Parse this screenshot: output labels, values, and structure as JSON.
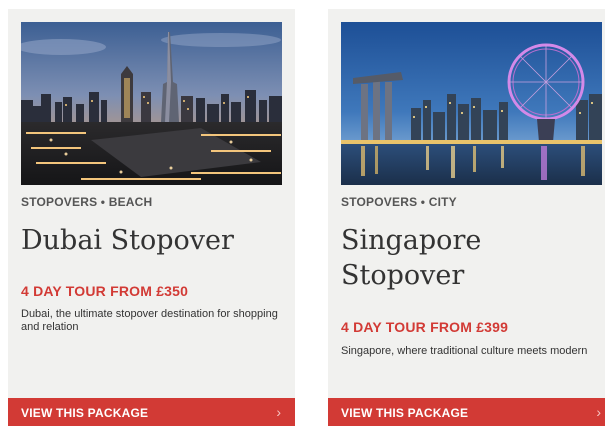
{
  "cards": [
    {
      "image_label": "Dubai skyline at dusk",
      "tags": "STOPOVERS • BEACH",
      "title": "Dubai Stopover",
      "price": "4 DAY TOUR FROM £350",
      "description": "Dubai, the ultimate stopover destination for shopping and relation",
      "cta": "VIEW THIS PACKAGE",
      "cta_icon": "chevron-right-icon"
    },
    {
      "image_label": "Singapore skyline at night",
      "tags": "STOPOVERS • CITY",
      "title": "Singapore Stopover",
      "price": "4 DAY TOUR FROM £399",
      "description": "Singapore, where traditional culture meets modern",
      "cta": "VIEW THIS PACKAGE",
      "cta_icon": "chevron-right-icon"
    }
  ],
  "colors": {
    "accent": "#d23a35",
    "card_bg": "#f1f1ef",
    "text": "#333333",
    "tag_text": "#555555"
  }
}
